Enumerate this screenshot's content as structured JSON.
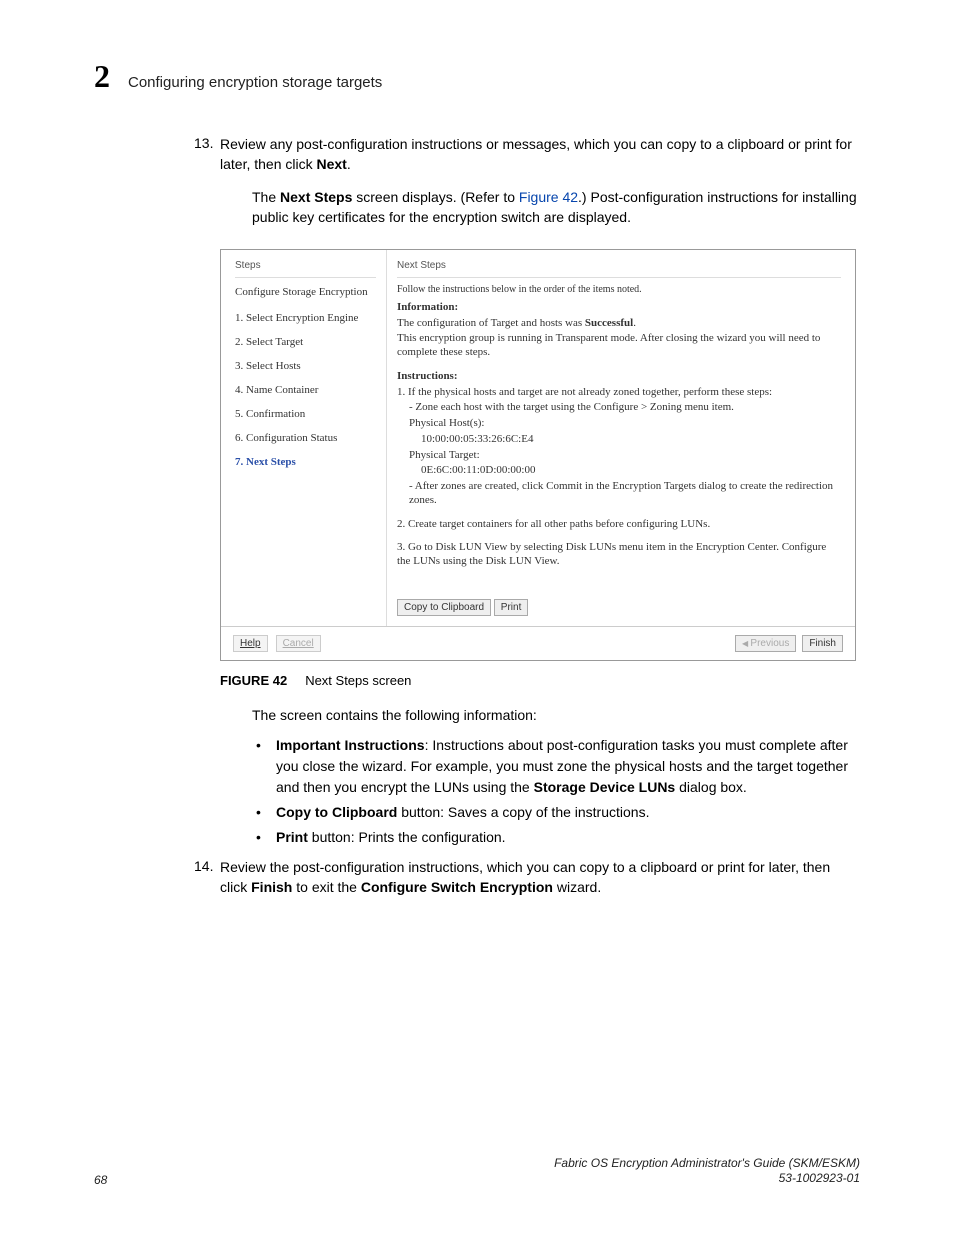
{
  "header": {
    "chapter_number": "2",
    "section_title": "Configuring encryption storage targets"
  },
  "step13": {
    "number": "13.",
    "text_before_bold": "Review any post-configuration instructions or messages, which you can copy to a clipboard or print for later, then click ",
    "bold": "Next",
    "text_after_bold": ".",
    "para2_before": "The ",
    "para2_bold": "Next Steps",
    "para2_mid": " screen displays. (Refer to ",
    "para2_link": "Figure 42",
    "para2_after": ".) Post-configuration instructions for installing public key certificates for the encryption switch are displayed."
  },
  "dialog": {
    "steps_header": "Steps",
    "title": "Configure Storage Encryption",
    "items": [
      "1. Select Encryption Engine",
      "2. Select Target",
      "3. Select Hosts",
      "4. Name Container",
      "5. Confirmation",
      "6. Configuration Status"
    ],
    "active_item": "7. Next Steps",
    "right": {
      "header": "Next Steps",
      "follow": "Follow the instructions below in the order of the items noted.",
      "info_hdr": "Information:",
      "info_l1a": "The configuration of Target and hosts was ",
      "info_l1b": "Successful",
      "info_l1c": ".",
      "info_l2": "This encryption group is running in Transparent mode. After closing the wizard you will need to complete these steps.",
      "instr_hdr": "Instructions:",
      "instr1": "1. If the physical hosts and target are not already zoned together, perform these steps:",
      "instr1a": "- Zone each host with the target using the Configure > Zoning menu item.",
      "instr1b": "Physical Host(s):",
      "instr1c": "10:00:00:05:33:26:6C:E4",
      "instr1d": "Physical Target:",
      "instr1e": "0E:6C:00:11:0D:00:00:00",
      "instr1f": "- After zones are created, click Commit in the Encryption Targets dialog to create the redirection zones.",
      "instr2": "2. Create target containers for all other paths before configuring LUNs.",
      "instr3": "3. Go to Disk LUN View by selecting Disk LUNs menu item in the Encryption Center. Configure the LUNs using the Disk LUN View.",
      "btn_copy": "Copy to Clipboard",
      "btn_print": "Print"
    },
    "bottom": {
      "help": "Help",
      "cancel": "Cancel",
      "previous": "Previous",
      "finish": "Finish"
    }
  },
  "figure": {
    "label": "FIGURE 42",
    "caption": "Next Steps screen"
  },
  "post_figure_intro": "The screen contains the following information:",
  "bullets": {
    "b1_bold": "Important Instructions",
    "b1_rest": ": Instructions about post-configuration tasks you must complete after you close the wizard. For example, you must zone the physical hosts and the target together and then you encrypt the LUNs using the ",
    "b1_bold2": "Storage Device LUNs",
    "b1_rest2": " dialog box.",
    "b2_bold": "Copy to Clipboard",
    "b2_rest": " button: Saves a copy of the instructions.",
    "b3_bold": "Print",
    "b3_rest": " button: Prints the configuration."
  },
  "step14": {
    "number": "14.",
    "text_before": "Review the post-configuration instructions, which you can copy to a clipboard or print for later, then click ",
    "bold1": "Finish",
    "mid": " to exit the ",
    "bold2": "Configure Switch Encryption",
    "after": " wizard."
  },
  "footer": {
    "page": "68",
    "doc_title": "Fabric OS Encryption Administrator's Guide (SKM/ESKM)",
    "doc_num": "53-1002923-01"
  }
}
